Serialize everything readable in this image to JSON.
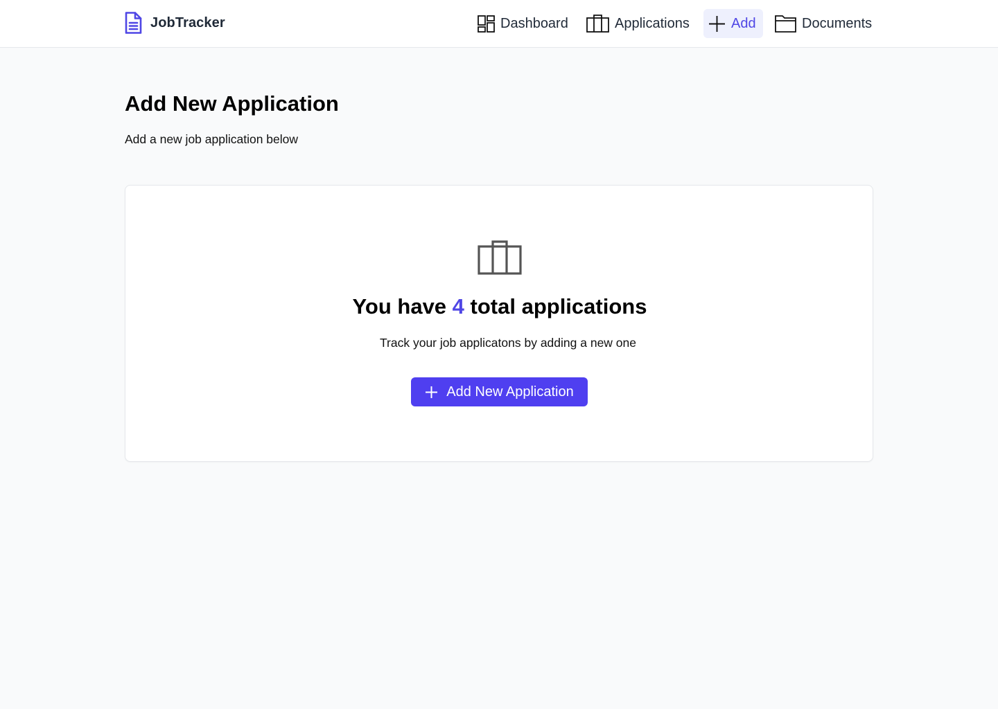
{
  "brand": {
    "name": "JobTracker"
  },
  "nav": {
    "dashboard": "Dashboard",
    "applications": "Applications",
    "add": "Add",
    "documents": "Documents",
    "active": "add"
  },
  "page": {
    "title": "Add New Application",
    "subtitle": "Add a new job application below"
  },
  "card": {
    "heading_prefix": "You have ",
    "count": "4",
    "heading_suffix": " total applications",
    "text": "Track your job applicatons by adding a new one",
    "button_label": "Add New Application"
  },
  "icons": {
    "brand": "document-icon",
    "dashboard": "grid-icon",
    "applications": "briefcase-icon",
    "add": "plus-icon",
    "documents": "folder-icon",
    "card": "briefcase-icon",
    "button": "plus-icon"
  },
  "colors": {
    "accent": "#4f46e5",
    "button": "#4f3ff0",
    "active_nav_bg": "#eef0fd",
    "page_bg": "#f9fafb"
  }
}
